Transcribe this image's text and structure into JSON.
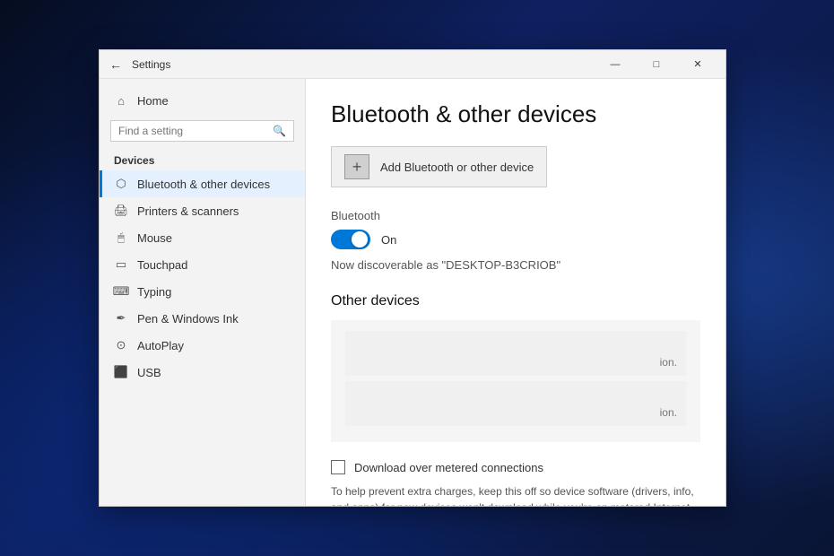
{
  "desktop": {
    "bg": "#0a1a3a"
  },
  "window": {
    "title": "Settings",
    "titlebar": {
      "back_label": "←",
      "title": "Settings",
      "min_label": "—",
      "max_label": "□",
      "close_label": "✕"
    }
  },
  "sidebar": {
    "home_label": "Home",
    "search_placeholder": "Find a setting",
    "section_label": "Devices",
    "items": [
      {
        "id": "bluetooth",
        "label": "Bluetooth & other devices",
        "active": true
      },
      {
        "id": "printers",
        "label": "Printers & scanners",
        "active": false
      },
      {
        "id": "mouse",
        "label": "Mouse",
        "active": false
      },
      {
        "id": "touchpad",
        "label": "Touchpad",
        "active": false
      },
      {
        "id": "typing",
        "label": "Typing",
        "active": false
      },
      {
        "id": "pen",
        "label": "Pen & Windows Ink",
        "active": false
      },
      {
        "id": "autoplay",
        "label": "AutoPlay",
        "active": false
      },
      {
        "id": "usb",
        "label": "USB",
        "active": false
      }
    ]
  },
  "content": {
    "page_title": "Bluetooth & other devices",
    "add_device": {
      "label": "Add Bluetooth or other device",
      "icon": "+"
    },
    "bluetooth": {
      "section_label": "Bluetooth",
      "toggle_state": "On",
      "discoverable_text": "Now discoverable as \"DESKTOP-B3CRIOB\""
    },
    "other_devices": {
      "section_title": "Other devices",
      "partial_text_1": "ion.",
      "partial_text_2": "ion."
    },
    "download": {
      "checkbox_label": "Download over metered connections",
      "help_text": "To help prevent extra charges, keep this off so device software (drivers, info, and apps) for new devices won't download while you're on metered Internet connections."
    }
  }
}
